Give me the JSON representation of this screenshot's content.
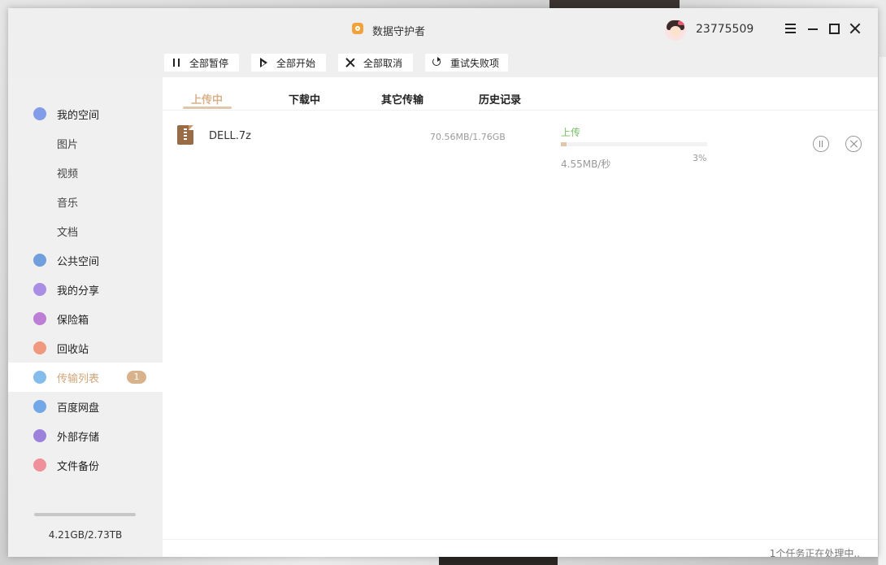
{
  "app": {
    "title": "数据守护者",
    "user_id": "23775509"
  },
  "toolbar": {
    "pause_all": "全部暂停",
    "start_all": "全部开始",
    "cancel_all": "全部取消",
    "retry_failed": "重试失败项"
  },
  "sidebar": {
    "items": [
      {
        "label": "我的空间",
        "icon": "folder-icon",
        "color": "#6f8de8"
      },
      {
        "label": "图片",
        "sub": true
      },
      {
        "label": "视频",
        "sub": true
      },
      {
        "label": "音乐",
        "sub": true
      },
      {
        "label": "文档",
        "sub": true
      },
      {
        "label": "公共空间",
        "icon": "send-icon",
        "color": "#5b8fd8"
      },
      {
        "label": "我的分享",
        "icon": "share-icon",
        "color": "#9d7be2"
      },
      {
        "label": "保险箱",
        "icon": "safe-icon",
        "color": "#b46bd0"
      },
      {
        "label": "回收站",
        "icon": "trash-icon",
        "color": "#f08a6a"
      },
      {
        "label": "传输列表",
        "icon": "transfer-icon",
        "color": "#6fb0e8",
        "badge": "1",
        "active": true
      },
      {
        "label": "百度网盘",
        "icon": "cloud-icon",
        "color": "#5c9ae6"
      },
      {
        "label": "外部存储",
        "icon": "usb-icon",
        "color": "#8e6fd8"
      },
      {
        "label": "文件备份",
        "icon": "backup-icon",
        "color": "#ef7f8b"
      }
    ],
    "storage": {
      "text": "4.21GB/2.73TB",
      "fraction": 0.0015
    }
  },
  "tabs": [
    "上传中",
    "下载中",
    "其它传输",
    "历史记录"
  ],
  "transfer": {
    "file_name": "DELL.7z",
    "size": "70.56MB/1.76GB",
    "status": "上传",
    "speed": "4.55MB/秒",
    "percent_label": "3%",
    "progress": 0.04
  },
  "footer": {
    "status": "1个任务正在处理中.."
  },
  "colors": {
    "accent": "#d8b28b",
    "status_green": "#7bbf6a"
  }
}
